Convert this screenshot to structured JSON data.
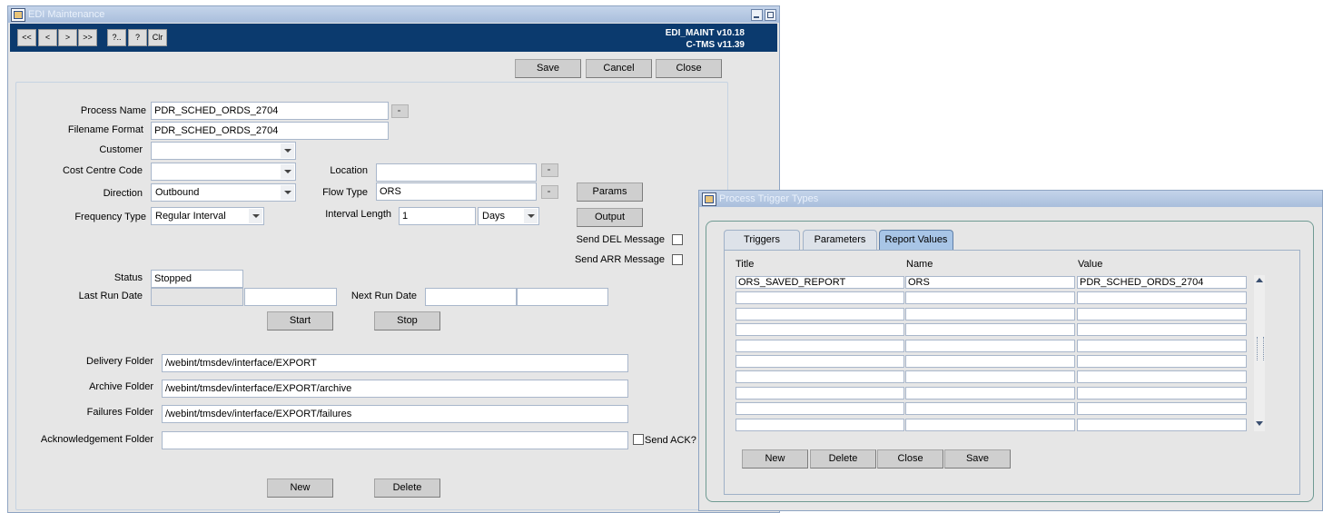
{
  "main_window": {
    "title": "EDI Maintenance",
    "nav_buttons": [
      "<<",
      "<",
      ">",
      ">>",
      "?..",
      "?",
      "Clr"
    ],
    "version_line1": "EDI_MAINT v10.18",
    "version_line2": "C-TMS v11.39",
    "top_buttons": {
      "save": "Save",
      "cancel": "Cancel",
      "close": "Close"
    },
    "form": {
      "process_name_label": "Process Name",
      "process_name_value": "PDR_SCHED_ORDS_2704",
      "filename_format_label": "Filename Format",
      "filename_format_value": "PDR_SCHED_ORDS_2704",
      "customer_label": "Customer",
      "customer_value": "",
      "cost_centre_label": "Cost Centre Code",
      "cost_centre_value": "",
      "location_label": "Location",
      "location_value": "",
      "direction_label": "Direction",
      "direction_value": "Outbound",
      "flow_type_label": "Flow Type",
      "flow_type_value": "ORS",
      "params_button": "Params",
      "frequency_type_label": "Frequency Type",
      "frequency_type_value": "Regular Interval",
      "interval_length_label": "Interval Length",
      "interval_length_value": "1",
      "interval_unit_value": "Days",
      "output_button": "Output",
      "send_del_label": "Send DEL Message",
      "send_arr_label": "Send ARR Message",
      "status_label": "Status",
      "status_value": "Stopped",
      "last_run_label": "Last Run Date",
      "next_run_label": "Next Run Date",
      "start_button": "Start",
      "stop_button": "Stop",
      "delivery_folder_label": "Delivery Folder",
      "delivery_folder_value": "/webint/tmsdev/interface/EXPORT",
      "archive_folder_label": "Archive Folder",
      "archive_folder_value": "/webint/tmsdev/interface/EXPORT/archive",
      "failures_folder_label": "Failures Folder",
      "failures_folder_value": "/webint/tmsdev/interface/EXPORT/failures",
      "ack_folder_label": "Acknowledgement Folder",
      "ack_folder_value": "",
      "send_ack_label": "Send ACK?",
      "new_button": "New",
      "delete_button": "Delete"
    }
  },
  "trigger_window": {
    "title": "Process Trigger Types",
    "tabs": [
      "Triggers",
      "Parameters",
      "Report Values"
    ],
    "active_tab": "Report Values",
    "columns": {
      "title": "Title",
      "name": "Name",
      "value": "Value"
    },
    "rows": [
      [
        "ORS_SAVED_REPORT",
        "ORS",
        "PDR_SCHED_ORDS_2704"
      ],
      [
        "",
        "",
        ""
      ],
      [
        "",
        "",
        ""
      ],
      [
        "",
        "",
        ""
      ],
      [
        "",
        "",
        ""
      ],
      [
        "",
        "",
        ""
      ],
      [
        "",
        "",
        ""
      ],
      [
        "",
        "",
        ""
      ],
      [
        "",
        "",
        ""
      ],
      [
        "",
        "",
        ""
      ]
    ],
    "buttons": {
      "new": "New",
      "delete": "Delete",
      "close": "Close",
      "save": "Save"
    }
  },
  "colors": {
    "nav_bar": "#0b3a6e",
    "window_bg": "#e6e6e6",
    "active_tab": "#a8c5e6"
  }
}
